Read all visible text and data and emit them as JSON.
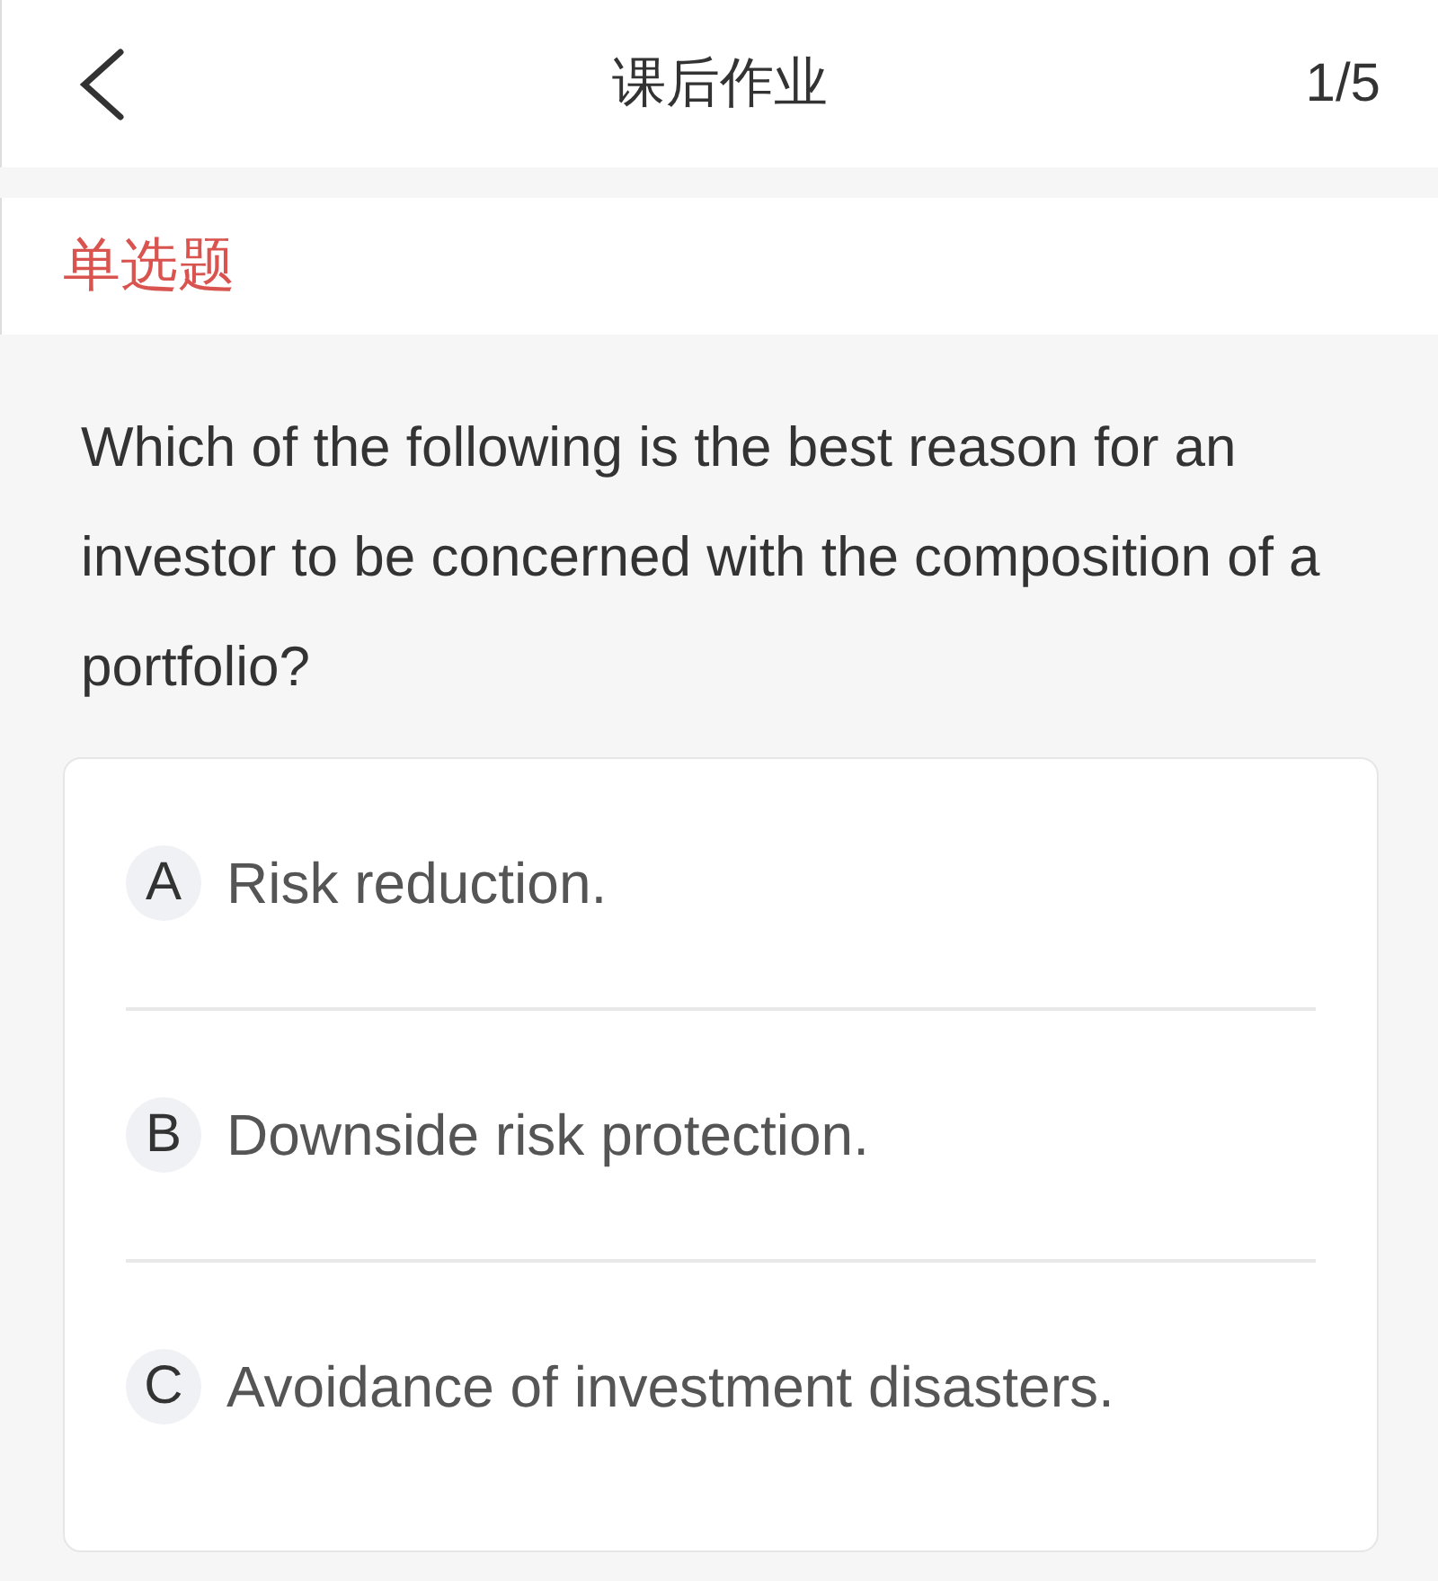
{
  "header": {
    "title": "课后作业",
    "progress": "1/5"
  },
  "question": {
    "type_label": "单选题",
    "text": "Which of the following is the best reason for an investor to be concerned with the composition of a portfolio?",
    "options": [
      {
        "letter": "A",
        "text": "Risk reduction.",
        "selected": false
      },
      {
        "letter": "B",
        "text": "Downside risk protection.",
        "selected": false
      },
      {
        "letter": "C",
        "text": "Avoidance of investment disasters.",
        "selected": false
      }
    ]
  }
}
